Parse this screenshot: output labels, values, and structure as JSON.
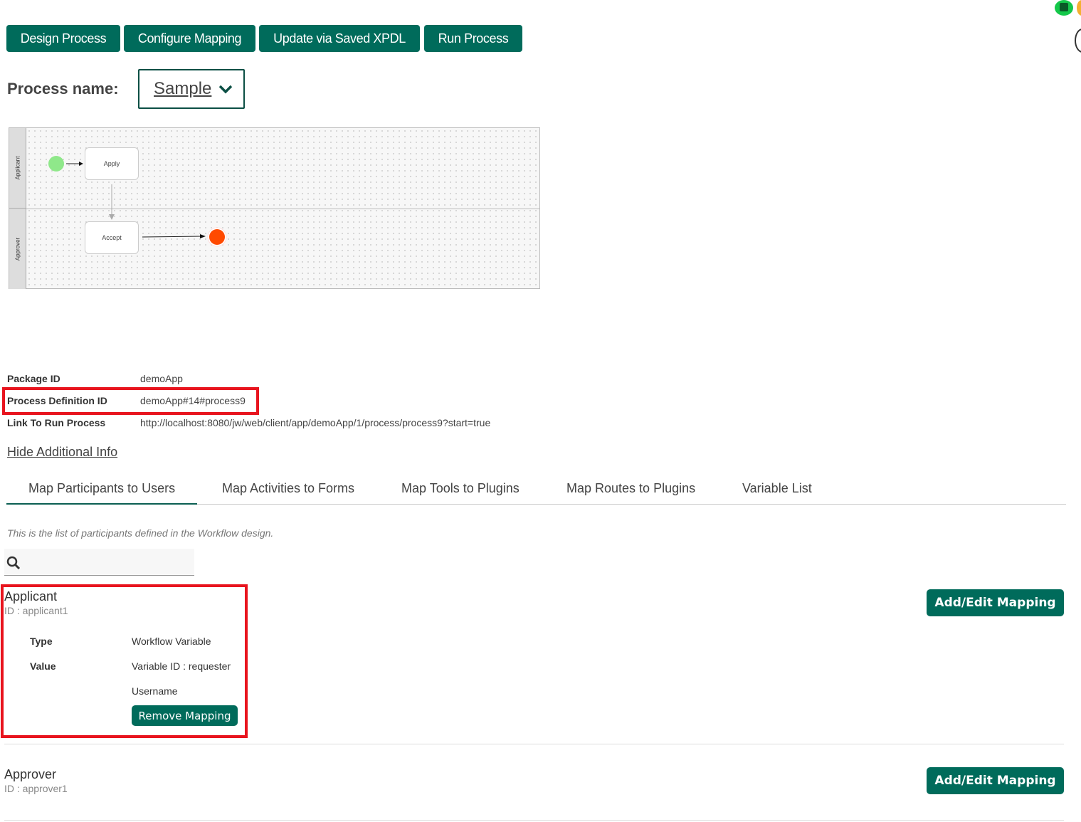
{
  "toolbar": {
    "design": "Design Process",
    "configure": "Configure Mapping",
    "update": "Update via Saved XPDL",
    "run": "Run Process"
  },
  "process": {
    "label": "Process name:",
    "selected": "Sample"
  },
  "diagram": {
    "lanes": [
      "Applicant",
      "Approver"
    ],
    "tasks": [
      "Apply",
      "Accept"
    ]
  },
  "info": {
    "rows": [
      {
        "key": "Package ID",
        "value": "demoApp"
      },
      {
        "key": "Process Definition ID",
        "value": "demoApp#14#process9"
      },
      {
        "key": "Link To Run Process",
        "value": "http://localhost:8080/jw/web/client/app/demoApp/1/process/process9?start=true"
      }
    ],
    "toggle": "Hide Additional Info"
  },
  "tabs": [
    "Map Participants to Users",
    "Map Activities to Forms",
    "Map Tools to Plugins",
    "Map Routes to Plugins",
    "Variable List"
  ],
  "description": "This is the list of participants defined in the Workflow design.",
  "participants": [
    {
      "name": "Applicant",
      "id": "ID : applicant1",
      "type_label": "Type",
      "type": "Workflow Variable",
      "value_label": "Value",
      "value": "Variable ID : requester",
      "value2": "Username",
      "remove": "Remove Mapping",
      "add": "Add/Edit Mapping"
    },
    {
      "name": "Approver",
      "id": "ID : approver1",
      "add": "Add/Edit Mapping"
    }
  ],
  "colors": {
    "primary": "#006b5b",
    "highlight": "#e8141e",
    "start": "#8fe88a",
    "end": "#ff4a00"
  }
}
